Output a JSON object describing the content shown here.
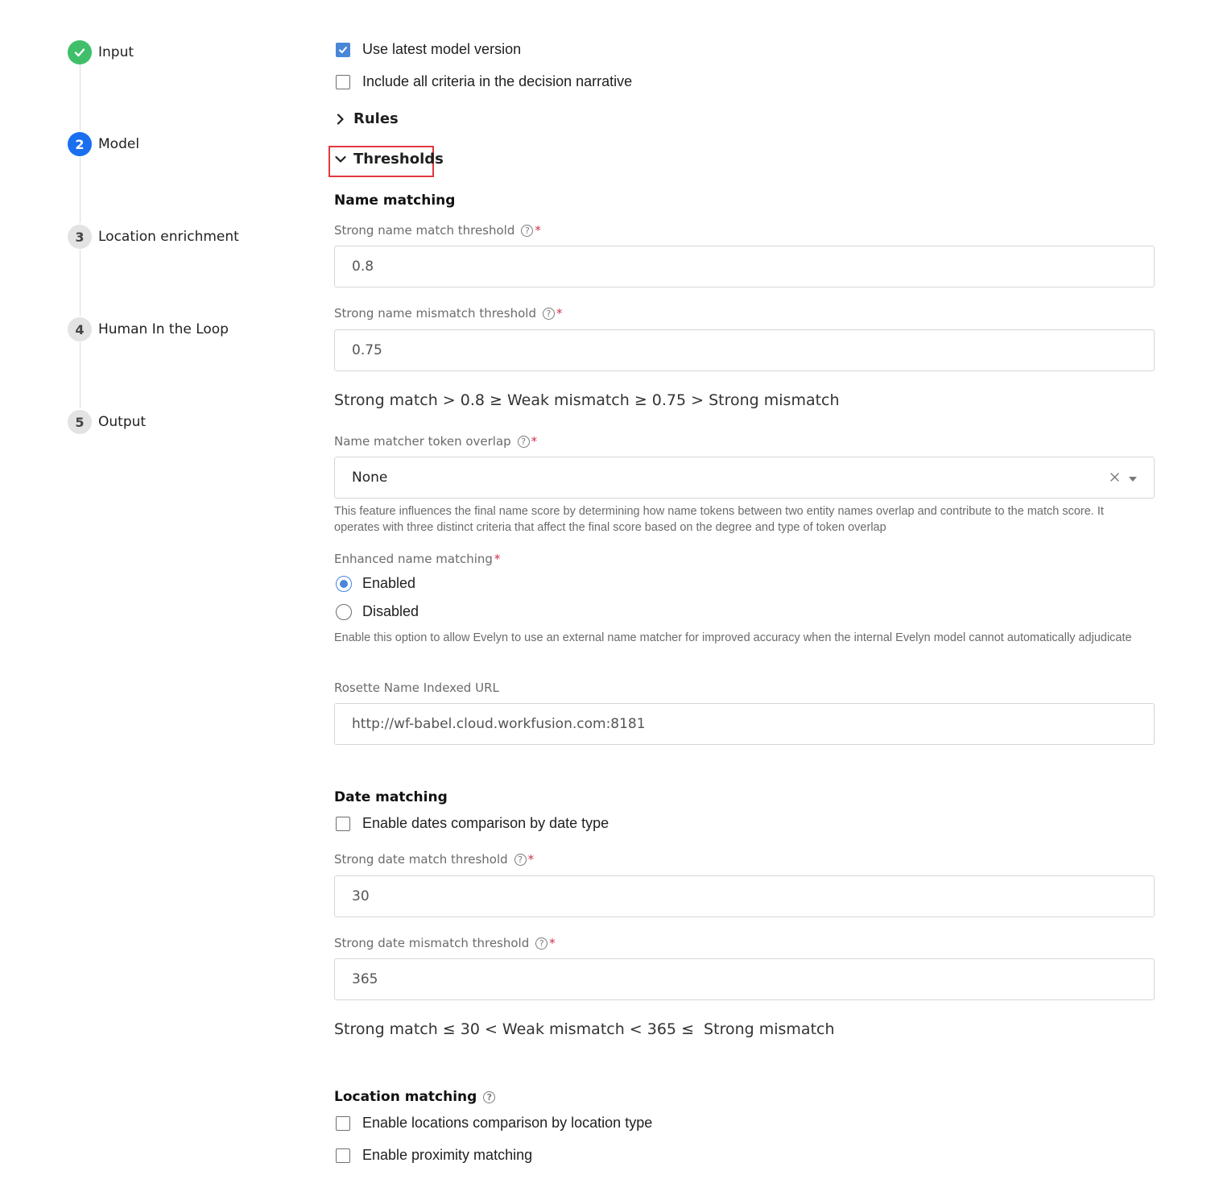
{
  "stepper": {
    "steps": [
      {
        "number": "1",
        "label": "Input",
        "status": "done"
      },
      {
        "number": "2",
        "label": "Model",
        "status": "active"
      },
      {
        "number": "3",
        "label": "Location enrichment",
        "status": "pending"
      },
      {
        "number": "4",
        "label": "Human In the Loop",
        "status": "pending"
      },
      {
        "number": "5",
        "label": "Output",
        "status": "pending"
      }
    ]
  },
  "options": {
    "use_latest": {
      "label": "Use latest model version",
      "checked": true
    },
    "include_all": {
      "label": "Include all criteria in the decision narrative",
      "checked": false
    }
  },
  "sections": {
    "rules": "Rules",
    "thresholds": "Thresholds"
  },
  "name_matching": {
    "title": "Name matching",
    "strong_match_label": "Strong name match threshold",
    "strong_match_value": "0.8",
    "strong_mismatch_label": "Strong name mismatch threshold",
    "strong_mismatch_value": "0.75",
    "formula": "Strong match > 0.8 ≥ Weak mismatch ≥ 0.75 > Strong mismatch",
    "token_overlap_label": "Name matcher token overlap",
    "token_overlap_value": "None",
    "token_overlap_help": "This feature influences the final name score by determining how name tokens between two entity names overlap and contribute to the match score. It operates with three distinct criteria that affect the final score based on the degree and type of token overlap",
    "enhanced_label": "Enhanced name matching",
    "enabled_label": "Enabled",
    "disabled_label": "Disabled",
    "enhanced_help": "Enable this option to allow Evelyn to use an external name matcher for improved accuracy when the internal Evelyn model cannot automatically adjudicate",
    "rosette_label": "Rosette Name Indexed URL",
    "rosette_value": "http://wf-babel.cloud.workfusion.com:8181"
  },
  "date_matching": {
    "title": "Date matching",
    "enable_label": "Enable dates comparison by date type",
    "strong_match_label": "Strong date match threshold",
    "strong_match_value": "30",
    "strong_mismatch_label": "Strong date mismatch threshold",
    "strong_mismatch_value": "365",
    "formula": "Strong match ≤ 30 < Weak mismatch < 365 ≤  Strong mismatch"
  },
  "location_matching": {
    "title": "Location matching",
    "enable_locations_label": "Enable locations comparison by location type",
    "enable_proximity_label": "Enable proximity matching"
  },
  "colors": {
    "accent": "#1a6ff0",
    "done": "#3fbf6a",
    "checkbox": "#4a86d8",
    "highlight": "#e0393e",
    "required": "#d0304a"
  }
}
